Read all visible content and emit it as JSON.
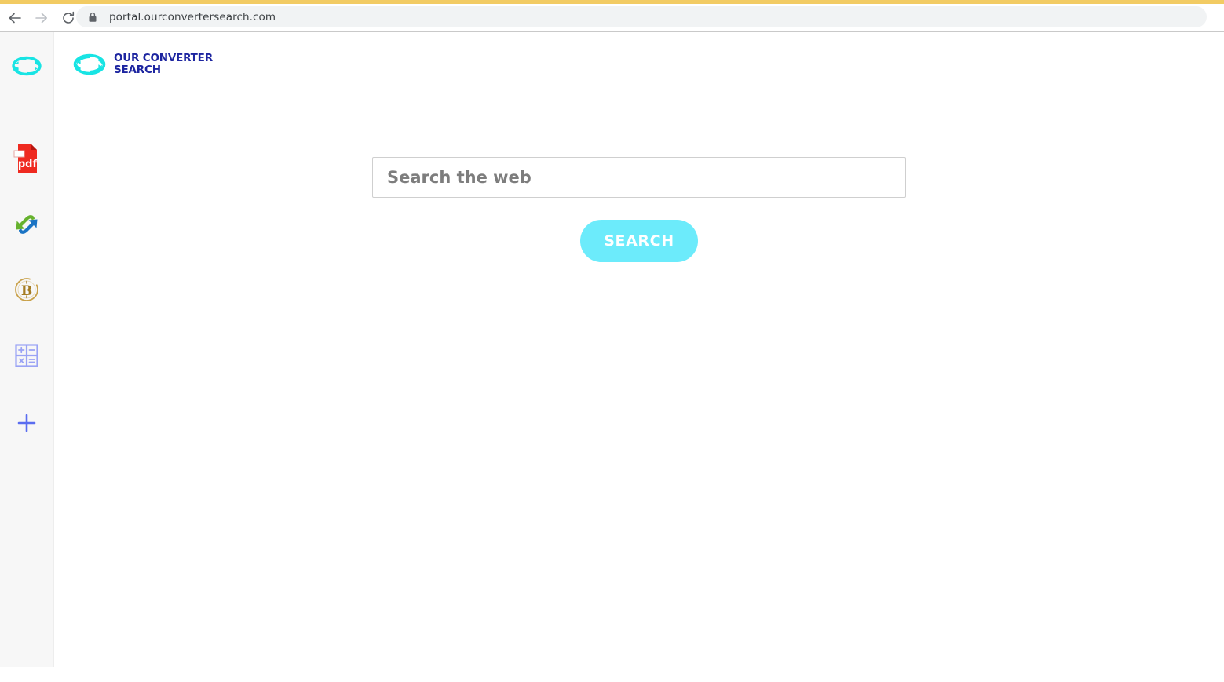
{
  "browser": {
    "accent_color": "#f2cb63",
    "back_label": "Back",
    "forward_label": "Forward",
    "reload_label": "Reload",
    "lock_icon": "lock-icon",
    "url": "portal.ourconvertersearch.com"
  },
  "sidebar": {
    "background": "#f7f7f7",
    "items": [
      {
        "name": "converter-search",
        "icon": "cycle-arrows-icon",
        "color": "#18e4e4"
      },
      {
        "name": "pdf-converter",
        "icon": "pdf-file-icon",
        "color": "#ef2a20",
        "label": "pdf"
      },
      {
        "name": "file-converter",
        "icon": "diagonal-convert-arrows-icon",
        "colors": [
          "#66b22e",
          "#1b74c4"
        ]
      },
      {
        "name": "crypto-converter",
        "icon": "bitcoin-icon",
        "color": "#b08326"
      },
      {
        "name": "calculator",
        "icon": "calculator-icon",
        "color": "#9aa3f5",
        "keys": [
          "+",
          "−",
          "×",
          "="
        ]
      },
      {
        "name": "add-app",
        "icon": "plus-icon",
        "color": "#5a6df0"
      }
    ],
    "collapse": {
      "icon": "chevron-left-icon",
      "color": "#3e3846"
    }
  },
  "page": {
    "logo": {
      "icon": "cycle-arrows-icon",
      "icon_color": "#18e4e4",
      "text_line1": "OUR CONVERTER",
      "text_line2": "SEARCH",
      "text_color": "#1d25a0"
    },
    "search": {
      "placeholder": "Search the web",
      "value": "",
      "button_label": "SEARCH",
      "button_color": "#6cebfb"
    }
  }
}
